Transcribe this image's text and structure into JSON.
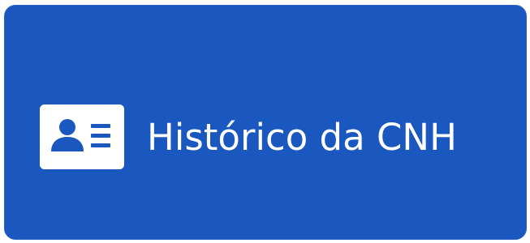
{
  "cnh_history_button": {
    "label": "Histórico da CNH",
    "icon": "id-card-icon",
    "background_color": "#1a57bf",
    "text_color": "#ffffff"
  }
}
